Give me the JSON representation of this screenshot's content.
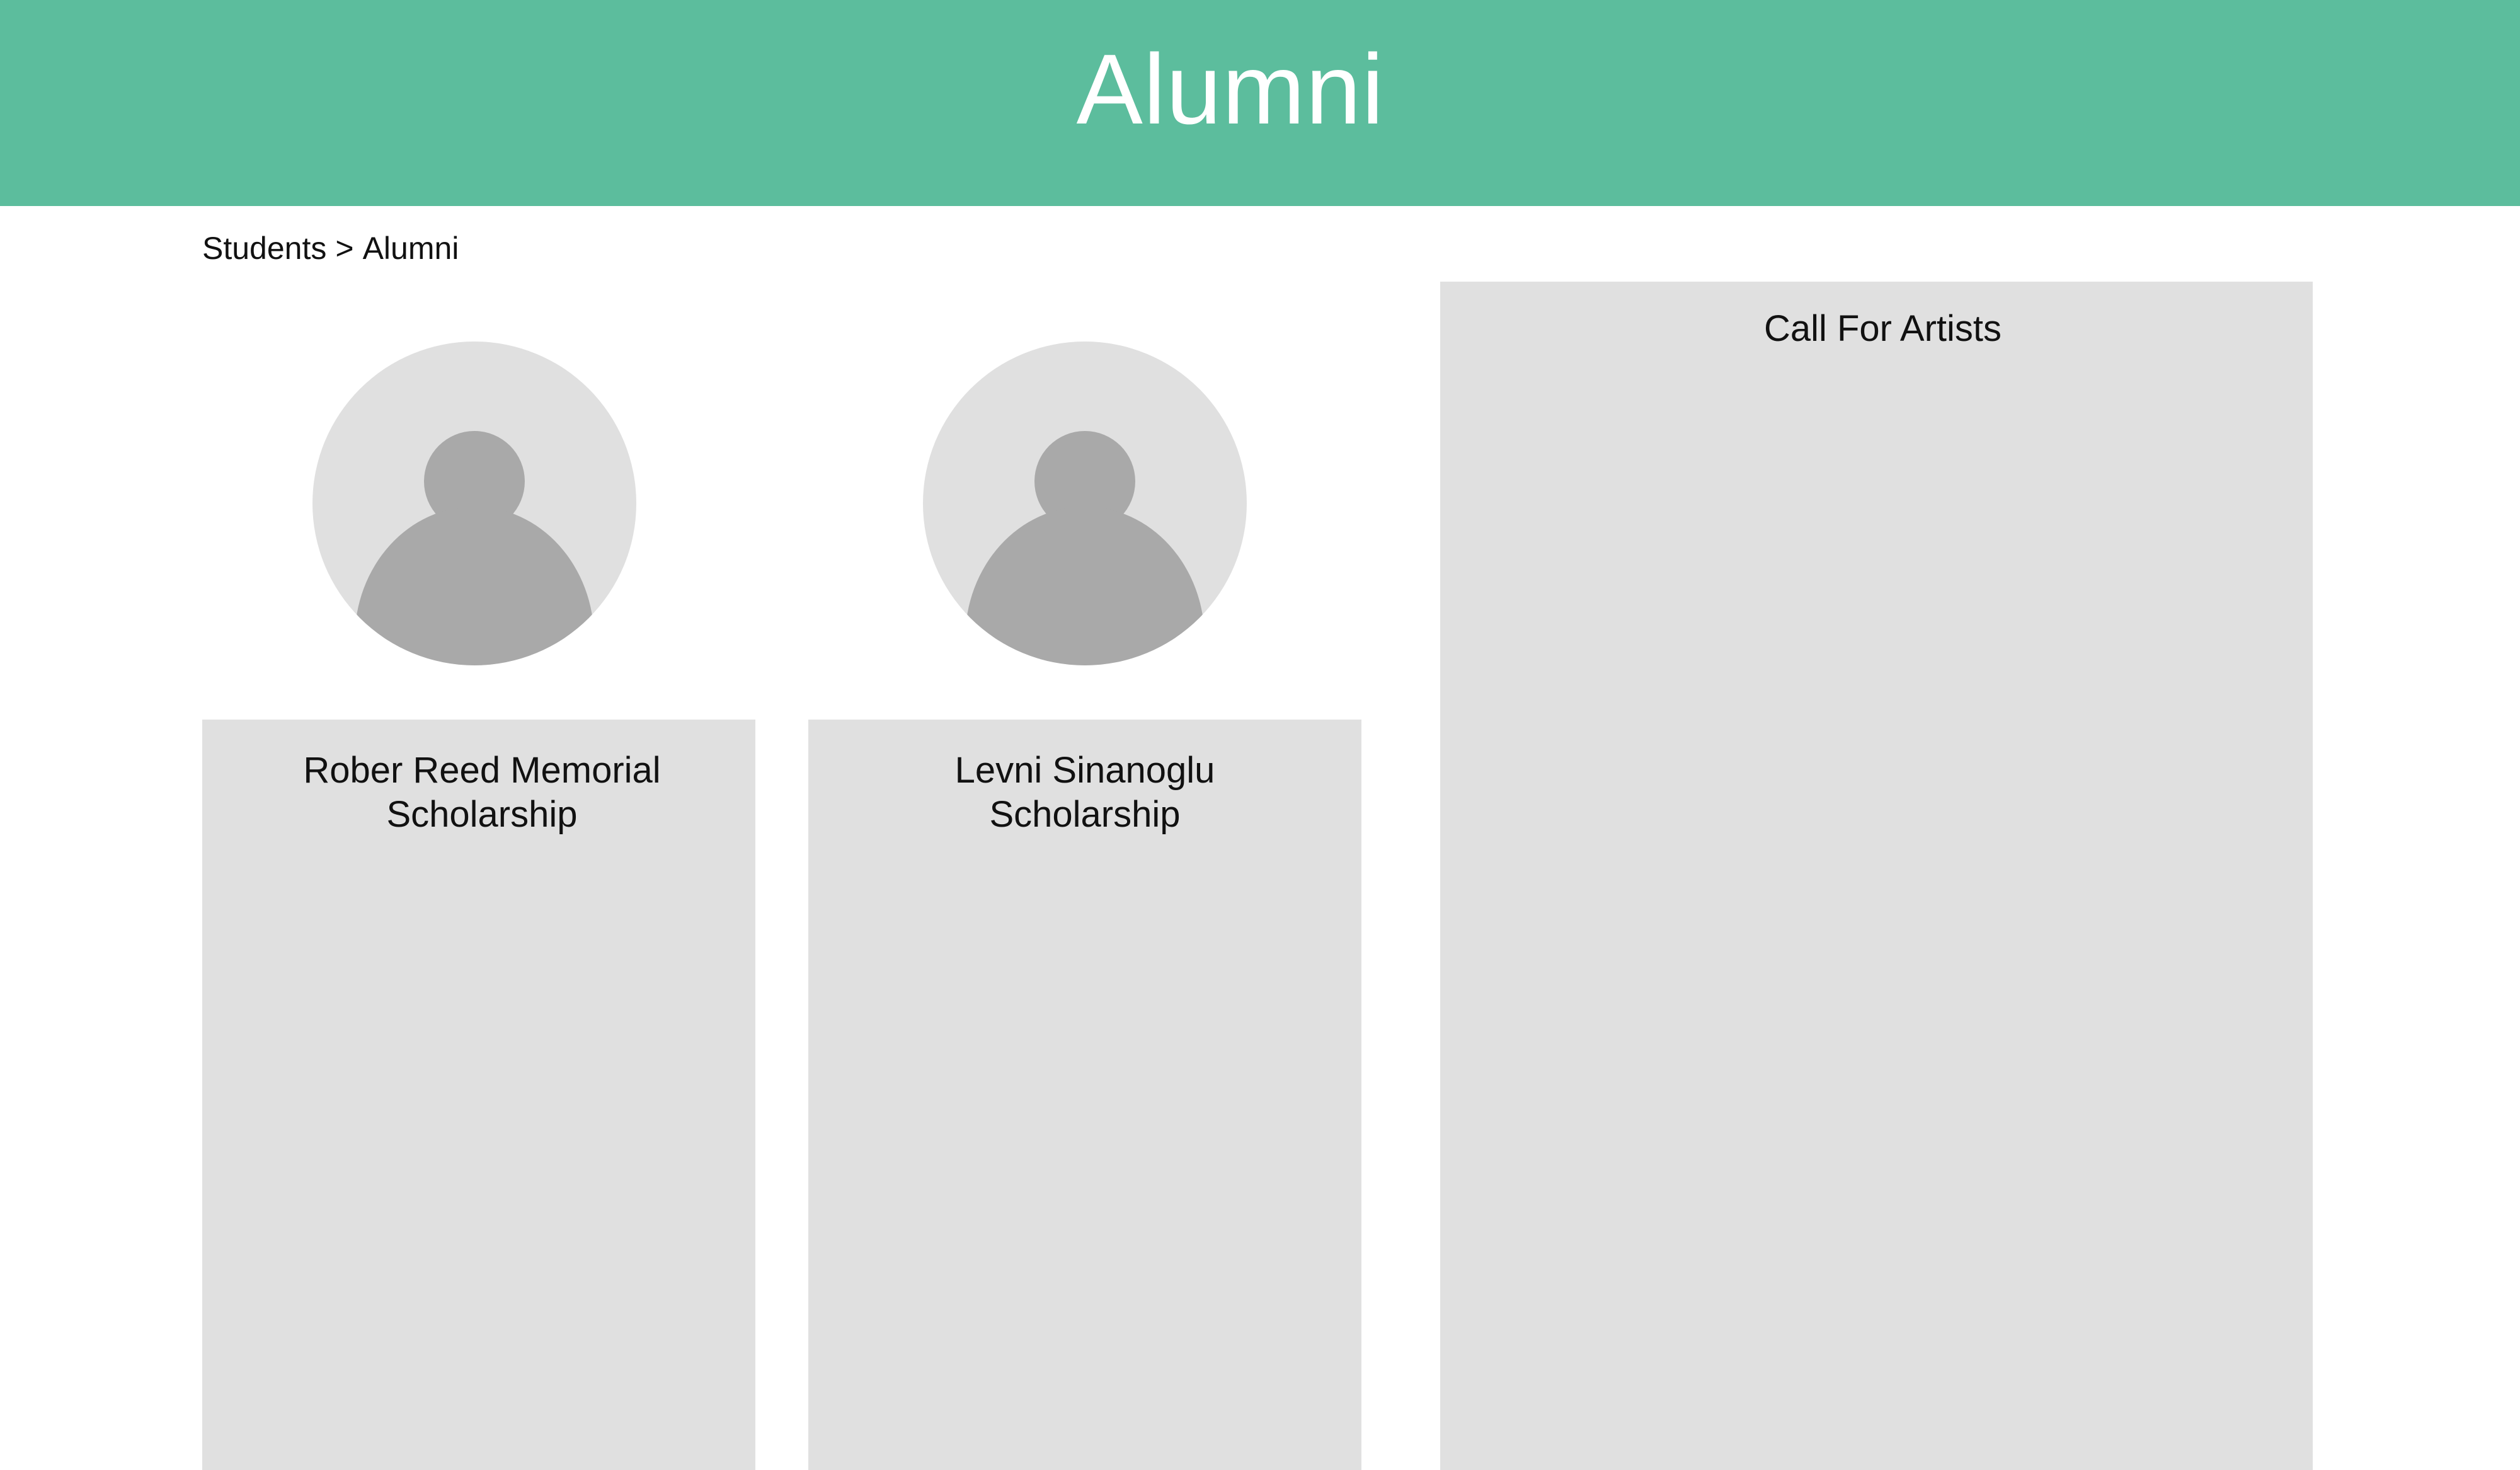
{
  "header": {
    "title": "Alumni",
    "background_color": "#5cbd9d",
    "text_color": "#ffffff"
  },
  "breadcrumb": {
    "items": [
      "Students",
      "Alumni"
    ],
    "separator": ">"
  },
  "profiles": [
    {
      "avatar_icon": "user-placeholder-icon",
      "title_line1": "Rober Reed Memorial",
      "title_line2": "Scholarship"
    },
    {
      "avatar_icon": "user-placeholder-icon",
      "title_line1": "Levni Sinanoglu",
      "title_line2": "Scholarship"
    }
  ],
  "sidebar": {
    "title": "Call For Artists"
  },
  "colors": {
    "panel": "#e0e0e0",
    "avatar_silhouette": "#a9a9a9"
  }
}
